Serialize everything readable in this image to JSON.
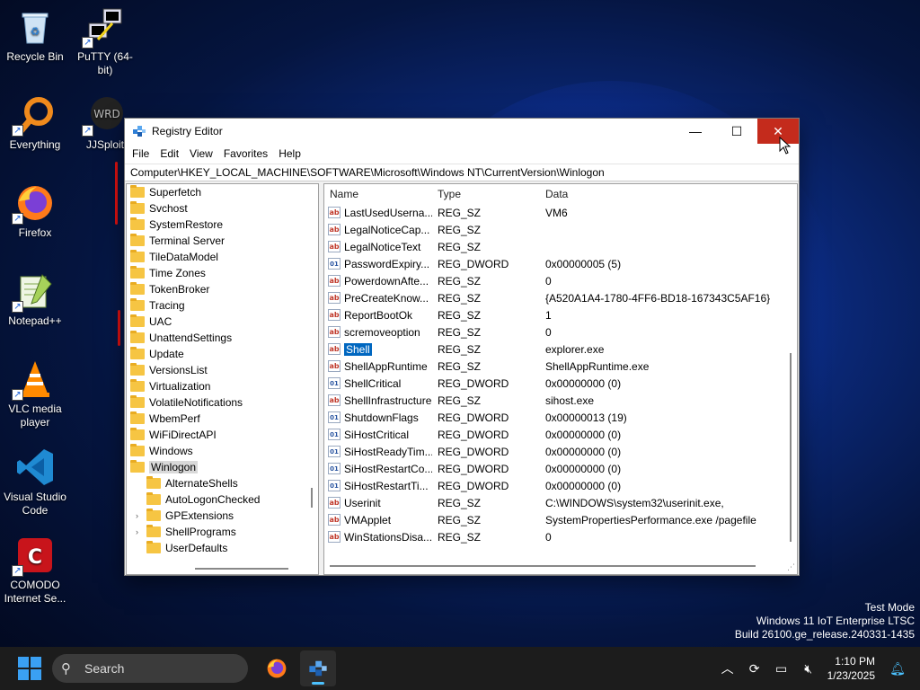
{
  "desktop": {
    "icons": [
      {
        "label": "Recycle Bin",
        "icon": "recycle-bin-icon"
      },
      {
        "label": "PuTTY (64-bit)",
        "icon": "putty-icon"
      },
      {
        "label": "Everything",
        "icon": "everything-search-icon"
      },
      {
        "label": "JJSploit",
        "icon": "jjsploit-icon"
      },
      {
        "label": "Firefox",
        "icon": "firefox-icon"
      },
      {
        "label": "Notepad++",
        "icon": "notepad-plus-plus-icon"
      },
      {
        "label": "VLC media player",
        "icon": "vlc-icon"
      },
      {
        "label": "Visual Studio Code",
        "icon": "vscode-icon"
      },
      {
        "label": "COMODO Internet Se...",
        "icon": "comodo-icon"
      }
    ],
    "watermark": [
      "Test Mode",
      "Windows 11 IoT Enterprise LTSC",
      "Build 26100.ge_release.240331-1435"
    ]
  },
  "window": {
    "title": "Registry Editor",
    "menu": [
      "File",
      "Edit",
      "View",
      "Favorites",
      "Help"
    ],
    "address": "Computer\\HKEY_LOCAL_MACHINE\\SOFTWARE\\Microsoft\\Windows NT\\CurrentVersion\\Winlogon",
    "tree": [
      {
        "label": "Superfetch",
        "level": 0
      },
      {
        "label": "Svchost",
        "level": 0
      },
      {
        "label": "SystemRestore",
        "level": 0
      },
      {
        "label": "Terminal Server",
        "level": 0
      },
      {
        "label": "TileDataModel",
        "level": 0
      },
      {
        "label": "Time Zones",
        "level": 0
      },
      {
        "label": "TokenBroker",
        "level": 0
      },
      {
        "label": "Tracing",
        "level": 0
      },
      {
        "label": "UAC",
        "level": 0
      },
      {
        "label": "UnattendSettings",
        "level": 0
      },
      {
        "label": "Update",
        "level": 0
      },
      {
        "label": "VersionsList",
        "level": 0
      },
      {
        "label": "Virtualization",
        "level": 0
      },
      {
        "label": "VolatileNotifications",
        "level": 0
      },
      {
        "label": "WbemPerf",
        "level": 0
      },
      {
        "label": "WiFiDirectAPI",
        "level": 0
      },
      {
        "label": "Windows",
        "level": 0
      },
      {
        "label": "Winlogon",
        "level": 0,
        "selected": true
      },
      {
        "label": "AlternateShells",
        "level": 1
      },
      {
        "label": "AutoLogonChecked",
        "level": 1
      },
      {
        "label": "GPExtensions",
        "level": 1,
        "expander": true
      },
      {
        "label": "ShellPrograms",
        "level": 1,
        "expander": true
      },
      {
        "label": "UserDefaults",
        "level": 1
      }
    ],
    "columns": {
      "name": "Name",
      "type": "Type",
      "data": "Data"
    },
    "values": [
      {
        "name": "LastUsedUserna...",
        "type": "REG_SZ",
        "data": "VM6",
        "kind": "string"
      },
      {
        "name": "LegalNoticeCap...",
        "type": "REG_SZ",
        "data": "",
        "kind": "string"
      },
      {
        "name": "LegalNoticeText",
        "type": "REG_SZ",
        "data": "",
        "kind": "string"
      },
      {
        "name": "PasswordExpiry...",
        "type": "REG_DWORD",
        "data": "0x00000005 (5)",
        "kind": "binary"
      },
      {
        "name": "PowerdownAfte...",
        "type": "REG_SZ",
        "data": "0",
        "kind": "string"
      },
      {
        "name": "PreCreateKnow...",
        "type": "REG_SZ",
        "data": "{A520A1A4-1780-4FF6-BD18-167343C5AF16}",
        "kind": "string"
      },
      {
        "name": "ReportBootOk",
        "type": "REG_SZ",
        "data": "1",
        "kind": "string"
      },
      {
        "name": "scremoveoption",
        "type": "REG_SZ",
        "data": "0",
        "kind": "string"
      },
      {
        "name": "Shell",
        "type": "REG_SZ",
        "data": "explorer.exe",
        "kind": "string",
        "selected": true
      },
      {
        "name": "ShellAppRuntime",
        "type": "REG_SZ",
        "data": "ShellAppRuntime.exe",
        "kind": "string"
      },
      {
        "name": "ShellCritical",
        "type": "REG_DWORD",
        "data": "0x00000000 (0)",
        "kind": "binary"
      },
      {
        "name": "ShellInfrastructure",
        "type": "REG_SZ",
        "data": "sihost.exe",
        "kind": "string"
      },
      {
        "name": "ShutdownFlags",
        "type": "REG_DWORD",
        "data": "0x00000013 (19)",
        "kind": "binary"
      },
      {
        "name": "SiHostCritical",
        "type": "REG_DWORD",
        "data": "0x00000000 (0)",
        "kind": "binary"
      },
      {
        "name": "SiHostReadyTim...",
        "type": "REG_DWORD",
        "data": "0x00000000 (0)",
        "kind": "binary"
      },
      {
        "name": "SiHostRestartCo...",
        "type": "REG_DWORD",
        "data": "0x00000000 (0)",
        "kind": "binary"
      },
      {
        "name": "SiHostRestartTi...",
        "type": "REG_DWORD",
        "data": "0x00000000 (0)",
        "kind": "binary"
      },
      {
        "name": "Userinit",
        "type": "REG_SZ",
        "data": "C:\\WINDOWS\\system32\\userinit.exe,",
        "kind": "string"
      },
      {
        "name": "VMApplet",
        "type": "REG_SZ",
        "data": "SystemPropertiesPerformance.exe /pagefile",
        "kind": "string"
      },
      {
        "name": "WinStationsDisa...",
        "type": "REG_SZ",
        "data": "0",
        "kind": "string"
      }
    ]
  },
  "taskbar": {
    "search_placeholder": "Search",
    "apps": [
      "firefox-icon",
      "registry-editor-icon"
    ],
    "tray": [
      "chevron-up-icon",
      "sync-icon",
      "network-icon",
      "volume-muted-icon"
    ],
    "time": "1:10 PM",
    "date": "1/23/2025"
  }
}
